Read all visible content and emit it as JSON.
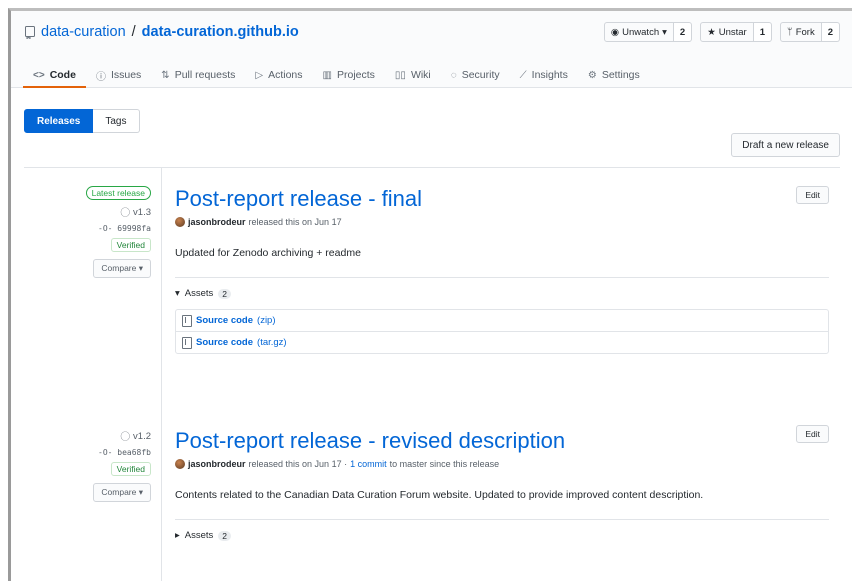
{
  "repo": {
    "owner": "data-curation",
    "separator": "/",
    "name": "data-curation.github.io"
  },
  "head_actions": [
    {
      "label": "Unwatch",
      "count": "2",
      "icon": "eye-icon",
      "caret": "▾"
    },
    {
      "label": "Unstar",
      "count": "1",
      "icon": "star-icon"
    },
    {
      "label": "Fork",
      "count": "2",
      "icon": "fork-icon"
    }
  ],
  "tabs": [
    {
      "label": "Code",
      "icon": "code-icon",
      "glyph": "<>",
      "selected": true
    },
    {
      "label": "Issues",
      "icon": "issue-icon",
      "glyph": "ⓘ"
    },
    {
      "label": "Pull requests",
      "icon": "pull-request-icon",
      "glyph": "⇅"
    },
    {
      "label": "Actions",
      "icon": "play-icon",
      "glyph": "▷"
    },
    {
      "label": "Projects",
      "icon": "project-icon",
      "glyph": "▥"
    },
    {
      "label": "Wiki",
      "icon": "book-icon",
      "glyph": "▯▯"
    },
    {
      "label": "Security",
      "icon": "shield-icon",
      "glyph": "◌"
    },
    {
      "label": "Insights",
      "icon": "graph-icon",
      "glyph": "⟋"
    },
    {
      "label": "Settings",
      "icon": "gear-icon",
      "glyph": "⚙"
    }
  ],
  "segment": {
    "releases": "Releases",
    "tags": "Tags"
  },
  "draft_button": "Draft a new release",
  "releases": [
    {
      "latest_badge": "Latest release",
      "tag": "v1.3",
      "commit": "69998fa",
      "verified": "Verified",
      "compare": "Compare ▾",
      "title": "Post-report release - final",
      "edit": "Edit",
      "author": "jasonbrodeur",
      "released_text": "released this on Jun 17",
      "description": "Updated for Zenodo archiving + readme",
      "assets_label": "Assets",
      "assets_count": "2",
      "assets": [
        {
          "name": "Source code",
          "ext": "(zip)"
        },
        {
          "name": "Source code",
          "ext": "(tar.gz)"
        }
      ]
    },
    {
      "tag": "v1.2",
      "commit": "bea68fb",
      "verified": "Verified",
      "compare": "Compare ▾",
      "title": "Post-report release - revised description",
      "edit": "Edit",
      "author": "jasonbrodeur",
      "released_text": "released this on Jun 17 ·",
      "commit_link": "1 commit",
      "released_suffix": "to master since this release",
      "description": "Contents related to the Canadian Data Curation Forum website. Updated to provide improved content description.",
      "assets_label": "Assets",
      "assets_count": "2"
    }
  ]
}
